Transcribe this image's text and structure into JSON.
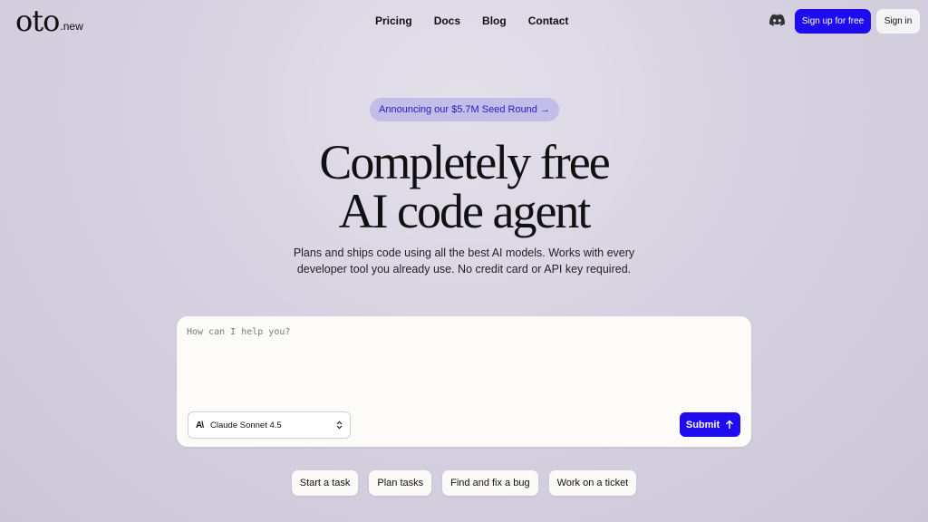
{
  "header": {
    "logo_main": "oto",
    "logo_suffix": ".new",
    "nav": [
      "Pricing",
      "Docs",
      "Blog",
      "Contact"
    ],
    "signup_label": "Sign up for free",
    "signin_label": "Sign in",
    "discord_icon": "discord-icon"
  },
  "hero": {
    "announcement": "Announcing our $5.7M Seed Round →",
    "title_line1": "Completely free",
    "title_line2": "AI code agent",
    "subtitle_line1": "Plans and ships code using all the best AI models. Works with every",
    "subtitle_line2": "developer tool you already use. No credit card or API key required."
  },
  "prompt": {
    "placeholder": "How can I help you?",
    "value": "",
    "model": "Claude Sonnet 4.5",
    "submit_label": "Submit"
  },
  "chips": [
    "Start a task",
    "Plan tasks",
    "Find and fix a bug",
    "Work on a ticket"
  ],
  "colors": {
    "accent": "#1f0bf0",
    "announce_bg": "#c3bdea",
    "announce_text": "#2b19b8"
  }
}
